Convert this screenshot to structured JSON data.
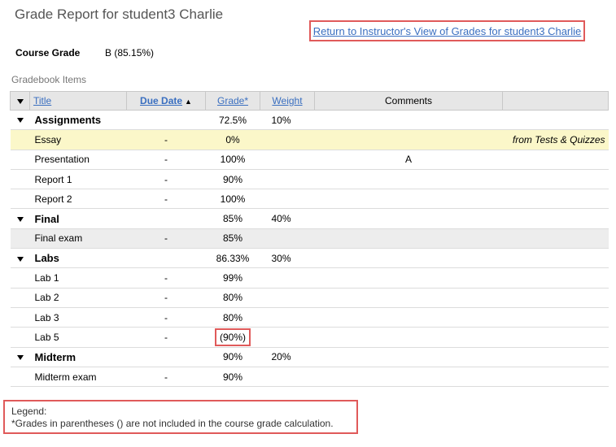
{
  "page": {
    "title": "Grade Report for student3 Charlie",
    "return_link": "Return to Instructor's View of Grades for student3 Charlie"
  },
  "course_grade": {
    "label": "Course Grade",
    "value": "B (85.15%)"
  },
  "gradebook_label": "Gradebook Items",
  "table": {
    "headers": {
      "title": "Title",
      "due_date": "Due Date",
      "grade": "Grade*",
      "weight": "Weight",
      "comments": "Comments"
    },
    "rows": [
      {
        "type": "category",
        "title": "Assignments",
        "due": "",
        "grade": "72.5%",
        "weight": "10%",
        "comment": "",
        "extra": ""
      },
      {
        "type": "item",
        "style": "highlight",
        "title": "Essay",
        "due": "-",
        "grade": "0%",
        "weight": "",
        "comment": "",
        "extra": "from Tests & Quizzes"
      },
      {
        "type": "item",
        "title": "Presentation",
        "due": "-",
        "grade": "100%",
        "weight": "",
        "comment": "A",
        "extra": ""
      },
      {
        "type": "item",
        "title": "Report 1",
        "due": "-",
        "grade": "90%",
        "weight": "",
        "comment": "",
        "extra": ""
      },
      {
        "type": "item",
        "title": "Report 2",
        "due": "-",
        "grade": "100%",
        "weight": "",
        "comment": "",
        "extra": ""
      },
      {
        "type": "category",
        "title": "Final",
        "due": "",
        "grade": "85%",
        "weight": "40%",
        "comment": "",
        "extra": ""
      },
      {
        "type": "item",
        "style": "shaded",
        "title": "Final exam",
        "due": "-",
        "grade": "85%",
        "weight": "",
        "comment": "",
        "extra": ""
      },
      {
        "type": "category",
        "title": "Labs",
        "due": "",
        "grade": "86.33%",
        "weight": "30%",
        "comment": "",
        "extra": ""
      },
      {
        "type": "item",
        "title": "Lab 1",
        "due": "-",
        "grade": "99%",
        "weight": "",
        "comment": "",
        "extra": ""
      },
      {
        "type": "item",
        "title": "Lab 2",
        "due": "-",
        "grade": "80%",
        "weight": "",
        "comment": "",
        "extra": ""
      },
      {
        "type": "item",
        "title": "Lab 3",
        "due": "-",
        "grade": "80%",
        "weight": "",
        "comment": "",
        "extra": ""
      },
      {
        "type": "item",
        "title": "Lab 5",
        "due": "-",
        "grade": "(90%)",
        "weight": "",
        "comment": "",
        "extra": "",
        "excluded": true
      },
      {
        "type": "category",
        "title": "Midterm",
        "due": "",
        "grade": "90%",
        "weight": "20%",
        "comment": "",
        "extra": ""
      },
      {
        "type": "item",
        "title": "Midterm exam",
        "due": "-",
        "grade": "90%",
        "weight": "",
        "comment": "",
        "extra": ""
      }
    ]
  },
  "legend": {
    "heading": "Legend:",
    "text": "*Grades in parentheses () are not included in the course grade calculation."
  },
  "colors": {
    "link": "#3a6fc0",
    "highlight_box": "#e05a5a",
    "header_bg": "#e6e6e6",
    "external_row_bg": "#fbf7c9"
  },
  "icons": [
    "collapse-all-icon",
    "sort-ascending-icon",
    "collapse-category-icon"
  ]
}
